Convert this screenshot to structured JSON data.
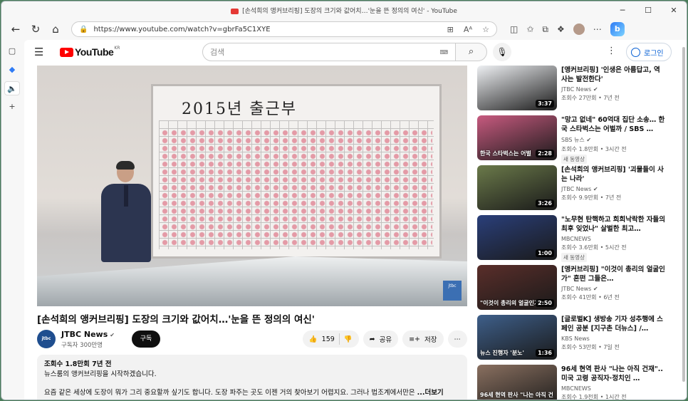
{
  "window": {
    "title": "[손석희의 앵커브리핑] 도장의 크기와 값어치…'눈을 뜬 정의의 여신' - YouTube"
  },
  "browser": {
    "url": "https://www.youtube.com/watch?v=gbrFa5C1XYE"
  },
  "youtube": {
    "logo_text": "YouTube",
    "region": "KR",
    "search_placeholder": "검색",
    "login_label": "로그인"
  },
  "video": {
    "board_title": "2015년  출근부",
    "watermark": "jtbc",
    "title": "[손석희의 앵커브리핑] 도장의 크기와 값어치…'눈을 뜬 정의의 여신'",
    "channel": "JTBC News",
    "channel_avatar": "jtbc news",
    "subscribers": "구독자 300만명",
    "subscribe_label": "구독",
    "likes": "159",
    "share_label": "공유",
    "save_label": "저장",
    "desc_meta": "조회수 1.8만회  7년 전",
    "desc_line1": "뉴스룸의 앵커브리핑을 시작하겠습니다.",
    "desc_body": "요즘 같은 세상에 도장이 뭐가 그리 중요할까 싶기도 합니다. 도장 파주는 곳도 이젠 거의 찾아보기 어렵지요. 그러나 법조계에서만은 ",
    "desc_more": "...더보기"
  },
  "recommendations": [
    {
      "title": "[앵커브리핑] '인생은 아름답고, 역사는 발전한다'",
      "channel": "JTBC News",
      "verified": true,
      "stats": "조회수 27만회 • 7년 전",
      "duration": "3:37",
      "color": "#eef0f3",
      "caption": "",
      "new_badge": ""
    },
    {
      "title": "\"망고 없네\" 60억대 집단 소송… 한국 스타벅스는 어벌까 / SBS …",
      "channel": "SBS 뉴스",
      "verified": true,
      "stats": "조회수 1.8만회 • 3시간 전",
      "duration": "2:28",
      "color": "#c75a7f",
      "caption": "한국 스타벅스는 어벌",
      "new_badge": "새 동영상"
    },
    {
      "title": "[손석희의 앵커브리핑] '괴물들이 사는 나라'",
      "channel": "JTBC News",
      "verified": true,
      "stats": "조회수 9.9만회 • 7년 전",
      "duration": "3:26",
      "color": "#6b7a4a",
      "caption": "",
      "new_badge": ""
    },
    {
      "title": "\"노무현 탄핵하고 희희낙락한 자들의 최후 잊었나\" 살벌한 최고…",
      "channel": "MBCNEWS",
      "verified": false,
      "stats": "조회수 3.6만회 • 5시간 전",
      "duration": "1:00",
      "color": "#2a3f7a",
      "caption": "",
      "new_badge": "새 동영상"
    },
    {
      "title": "[앵커브리핑] \"이것이 총리의 얼굴인가\" 혼떤 그들은…",
      "channel": "JTBC News",
      "verified": true,
      "stats": "조회수 41만회 • 6년 전",
      "duration": "2:50",
      "color": "#5a2e2a",
      "caption": "\"이것이 총리의 얼굴인가\"",
      "new_badge": ""
    },
    {
      "title": "[글로벌K] 생방송 기자 성추행에 스페인 공분 [지구촌 더뉴스] /…",
      "channel": "KBS News",
      "verified": false,
      "stats": "조회수 53만회 • 7일 전",
      "duration": "1:36",
      "color": "#3e5f8a",
      "caption": "뉴스 진행자 '분노'",
      "new_badge": ""
    },
    {
      "title": "96세 현역 판사 \"나는 아직 건재\"..미국 고령 공직자·정치인 …",
      "channel": "MBCNEWS",
      "verified": false,
      "stats": "조회수 1.9천회 • 1시간 전",
      "duration": "",
      "color": "#8a7060",
      "caption": "96세 현역 판사 \"나는 아직 건재\"",
      "new_badge": ""
    }
  ],
  "verified_mark": "✔"
}
